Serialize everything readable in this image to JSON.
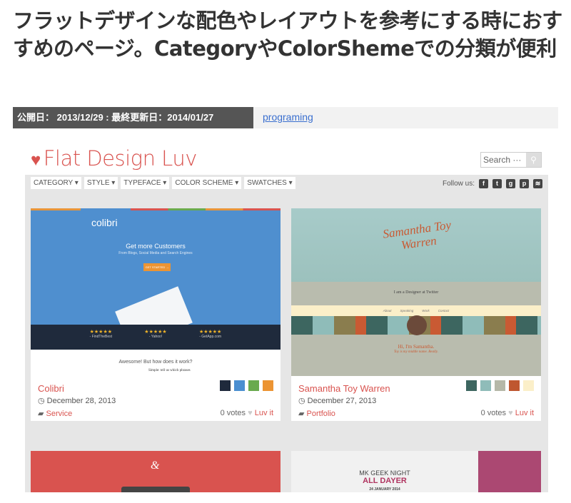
{
  "post": {
    "title": "フラットデザインな配色やレイアウトを参考にする時におすすめのページ。CategoryやColorShemeでの分類が便利",
    "dates": "公開日： 2013/12/29 : 最終更新日：2014/01/27",
    "category_link": "programing"
  },
  "site": {
    "logo": "Flat Design Luv",
    "search_placeholder": "Search ···",
    "nav": [
      "CATEGORY ▾",
      "STYLE ▾",
      "TYPEFACE ▾",
      "COLOR SCHEME ▾",
      "SWATCHES ▾"
    ],
    "follow_label": "Follow us:",
    "social_icons": [
      "facebook-icon",
      "twitter-icon",
      "google-plus-icon",
      "pinterest-icon",
      "rss-icon"
    ],
    "accent": "#d9534f"
  },
  "cards": [
    {
      "name": "Colibri",
      "date": "December 28, 2013",
      "category": "Service",
      "votes": "0 votes",
      "luv": "Luv it",
      "swatches": [
        "#1f2a3c",
        "#4b8fd1",
        "#6aaa4e",
        "#ec9433"
      ],
      "preview": {
        "brand": "colibri",
        "headline": "Get more Customers",
        "sub": "From Blogs, Social Media and Search Engines",
        "cta": "GET STARTED →",
        "reviews": [
          "- FindTheBest",
          "- Yahoo!",
          "- GetApp.com"
        ],
        "section": "Awesome! But how does it work?",
        "step": "Simple: tell us which phrases"
      }
    },
    {
      "name": "Samantha Toy Warren",
      "date": "December 27, 2013",
      "category": "Portfolio",
      "votes": "0 votes",
      "luv": "Luv it",
      "swatches": [
        "#3d6660",
        "#8fbcb9",
        "#b5b8a8",
        "#bf5730",
        "#fbefc9"
      ],
      "preview": {
        "logo": "Samantha Toy Warren",
        "tagline": "I am a Designer at Twitter",
        "menu": [
          "About",
          "Speaking",
          "Work",
          "Contact"
        ],
        "hi": "Hi, I'm Samantha.",
        "toy": "Toy is my middle name. Really."
      }
    },
    {
      "preview": {
        "mark": "&"
      }
    },
    {
      "preview": {
        "line1": "MK GEEK NIGHT",
        "line2": "ALL DAYER",
        "line3": "24 JANUARY 2014"
      }
    }
  ]
}
